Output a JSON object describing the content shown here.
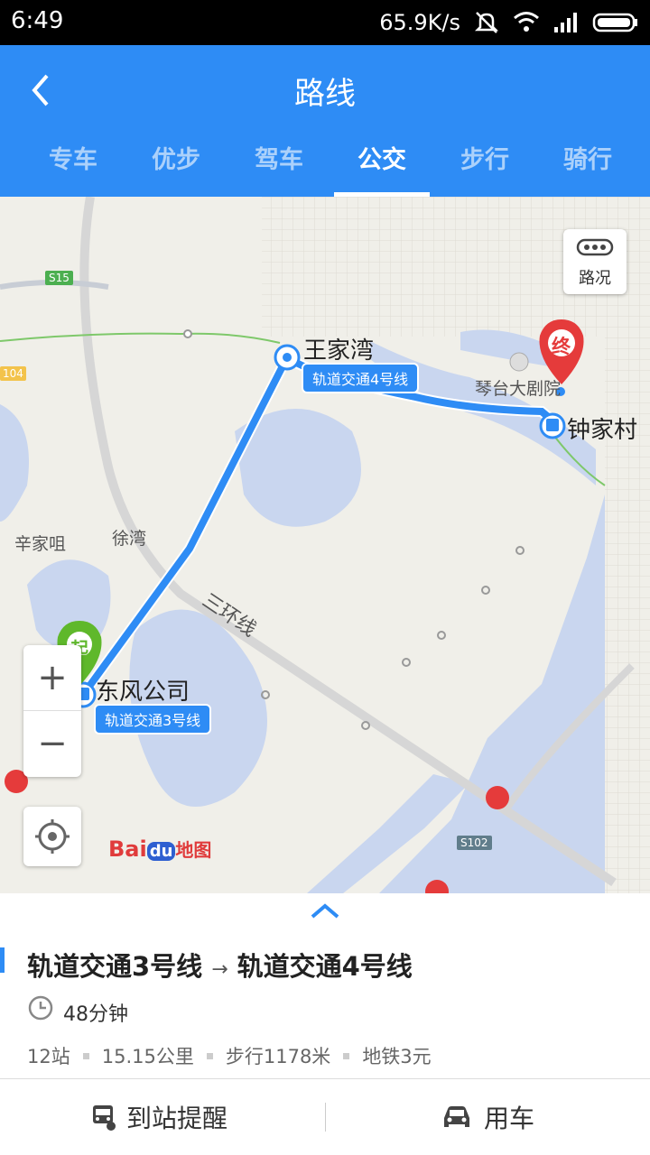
{
  "status_bar": {
    "time": "6:49",
    "net_speed": "65.9K/s"
  },
  "header": {
    "title": "路线"
  },
  "tabs": [
    {
      "label": "专车"
    },
    {
      "label": "优步"
    },
    {
      "label": "驾车"
    },
    {
      "label": "公交"
    },
    {
      "label": "步行"
    },
    {
      "label": "骑行"
    }
  ],
  "active_tab": "公交",
  "map": {
    "traffic_label": "路况",
    "places": {
      "wangjiawan": "王家湾",
      "zhongjiacun": "钟家村",
      "dongfeng": "东风公司",
      "qintai": "琴台大剧院",
      "xinjiazui": "辛家咀",
      "xuwan": "徐湾",
      "ring": "三环线",
      "s15": "S15",
      "s102": "S102",
      "r104": "104"
    },
    "line_labels": {
      "line4": "轨道交通4号线",
      "line3": "轨道交通3号线"
    },
    "markers": {
      "start": "起",
      "end": "终"
    },
    "zoom_in": "+",
    "zoom_out": "−",
    "logo": {
      "bai": "Bai",
      "du": "du",
      "ditu": "地图"
    },
    "colors": {
      "route": "#2e8cf5",
      "water": "#c9d6ef",
      "start": "#5fb82b",
      "end": "#e53b3b"
    }
  },
  "panel": {
    "route_from": "轨道交通3号线",
    "route_arrow": "→",
    "route_to": "轨道交通4号线",
    "duration": "48分钟",
    "meta": [
      "12站",
      "15.15公里",
      "步行1178米",
      "地铁3元"
    ],
    "btn_remind": "到站提醒",
    "btn_car": "用车"
  }
}
